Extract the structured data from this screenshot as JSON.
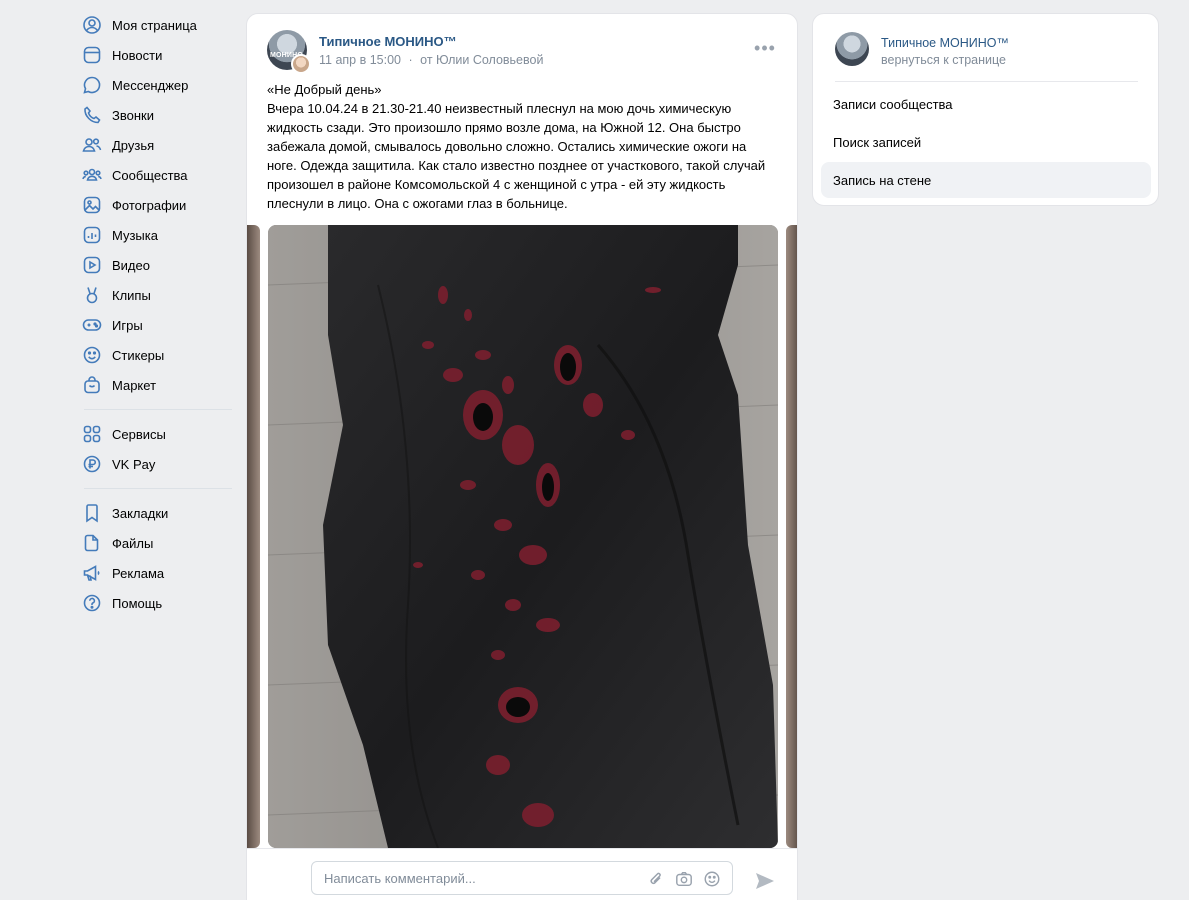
{
  "nav": {
    "main": [
      {
        "label": "Моя страница",
        "icon": "user-circle-icon"
      },
      {
        "label": "Новости",
        "icon": "news-icon"
      },
      {
        "label": "Мессенджер",
        "icon": "message-icon"
      },
      {
        "label": "Звонки",
        "icon": "phone-icon"
      },
      {
        "label": "Друзья",
        "icon": "friends-icon"
      },
      {
        "label": "Сообщества",
        "icon": "communities-icon"
      },
      {
        "label": "Фотографии",
        "icon": "photo-icon"
      },
      {
        "label": "Музыка",
        "icon": "music-icon"
      },
      {
        "label": "Видео",
        "icon": "video-icon"
      },
      {
        "label": "Клипы",
        "icon": "clips-icon"
      },
      {
        "label": "Игры",
        "icon": "gamepad-icon"
      },
      {
        "label": "Стикеры",
        "icon": "smile-icon"
      },
      {
        "label": "Маркет",
        "icon": "market-icon"
      }
    ],
    "services": [
      {
        "label": "Сервисы",
        "icon": "services-grid-icon"
      },
      {
        "label": "VK Pay",
        "icon": "vkpay-icon"
      }
    ],
    "other": [
      {
        "label": "Закладки",
        "icon": "bookmark-icon"
      },
      {
        "label": "Файлы",
        "icon": "file-icon"
      },
      {
        "label": "Реклама",
        "icon": "megaphone-icon"
      },
      {
        "label": "Помощь",
        "icon": "help-icon"
      }
    ]
  },
  "post": {
    "author": "Типичное МОНИНО™",
    "avatar_text": "МОНИНО",
    "date": "11 апр в 15:00",
    "separator": "·",
    "from": "от Юлии Соловьевой",
    "more_label": "•••",
    "text_lines": [
      "«Не Добрый день»",
      "Вчера 10.04.24 в 21.30-21.40 неизвестный плеснул на мою дочь химическую",
      "жидкость сзади. Это произошло прямо возле дома, на Южной 12. Она быстро",
      "забежала домой, смывалось довольно сложно. Остались химические ожоги на",
      "ноге. Одежда защитила. Как стало известно позднее от участкового, такой случай",
      "произошел в районе Комсомольской 4 с женщиной с утра - ей эту жидкость",
      "плеснули в лицо. Она с ожогами глаз в больнице."
    ]
  },
  "comment": {
    "placeholder": "Написать комментарий..."
  },
  "right_panel": {
    "title": "Типичное МОНИНО™",
    "subtitle": "вернуться к странице",
    "items": [
      {
        "label": "Записи сообщества",
        "active": false
      },
      {
        "label": "Поиск записей",
        "active": false
      },
      {
        "label": "Запись на стене",
        "active": true
      }
    ]
  },
  "colors": {
    "accent": "#447bba",
    "link": "#2a5885",
    "background": "#edeef0",
    "muted": "#818c99"
  }
}
